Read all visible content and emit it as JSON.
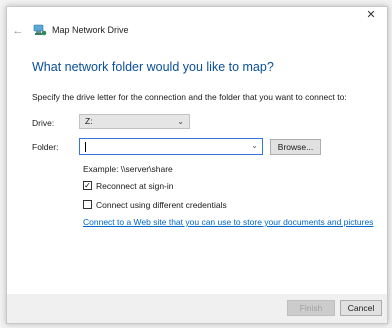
{
  "window": {
    "title": "Map Network Drive",
    "close_glyph": "✕",
    "back_glyph": "←"
  },
  "main": {
    "heading": "What network folder would you like to map?",
    "instruction": "Specify the drive letter for the connection and the folder that you want to connect to:"
  },
  "drive": {
    "label": "Drive:",
    "value": "Z:"
  },
  "folder": {
    "label": "Folder:",
    "value": "",
    "browse_label": "Browse..."
  },
  "example_text": "Example: \\\\server\\share",
  "options": {
    "reconnect_label": "Reconnect at sign-in",
    "reconnect_checked": true,
    "credentials_label": "Connect using different credentials",
    "credentials_checked": false
  },
  "link_text": "Connect to a Web site that you can use to store your documents and pictures",
  "footer": {
    "finish_label": "Finish",
    "cancel_label": "Cancel"
  },
  "icons": {
    "chevron": "⌄",
    "check": "✓"
  },
  "colors": {
    "heading": "#0a4f9a",
    "link": "#0066cc",
    "focus_border": "#3377dd"
  }
}
